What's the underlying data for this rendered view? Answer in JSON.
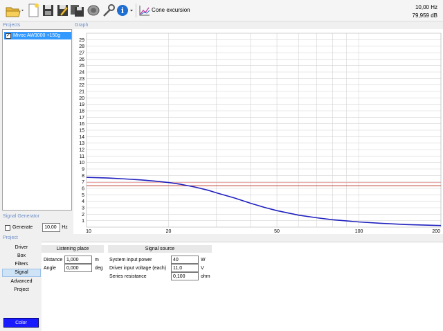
{
  "toolbar": {
    "mode_label": "Cone excursion",
    "frequency_readout": "10,00 Hz",
    "level_readout": "79,959 dB"
  },
  "sections": {
    "projects": "Projects",
    "graph": "Graph",
    "signal_generator": "Signal Generator",
    "project": "Project"
  },
  "projects": [
    {
      "name": "Mivoc AW3000 +150g",
      "checked": true
    }
  ],
  "signal_generator": {
    "generate_label": "Generate",
    "frequency": "10,00",
    "unit": "Hz"
  },
  "project_nav": [
    "Driver",
    "Box",
    "Filters",
    "Signal",
    "Advanced",
    "Project"
  ],
  "project_nav_active": "Signal",
  "color_button": "Color",
  "listening_place": {
    "title": "Listening place",
    "distance_label": "Distance",
    "distance_value": "1,000",
    "distance_unit": "m",
    "angle_label": "Angle",
    "angle_value": "0,000",
    "angle_unit": "deg"
  },
  "signal_source": {
    "title": "Signal source",
    "power_label": "System input power",
    "power_value": "40",
    "power_unit": "W",
    "voltage_label": "Driver input voltage (each)",
    "voltage_value": "11,0",
    "voltage_unit": "V",
    "resistance_label": "Series resistance",
    "resistance_value": "0,100",
    "resistance_unit": "ohm"
  },
  "chart_data": {
    "type": "line",
    "x_scale": "log",
    "xlim": [
      10,
      200
    ],
    "ylim": [
      0,
      30
    ],
    "x_ticks": [
      "10",
      "20",
      "50",
      "100",
      "200"
    ],
    "y_ticks": [
      "1",
      "2",
      "3",
      "4",
      "5",
      "6",
      "7",
      "8",
      "9",
      "10",
      "11",
      "12",
      "13",
      "14",
      "15",
      "16",
      "17",
      "18",
      "19",
      "20",
      "21",
      "22",
      "23",
      "24",
      "25",
      "26",
      "27",
      "28",
      "29"
    ],
    "grid": true,
    "series": [
      {
        "color": "#1f1fbf",
        "x": [
          10,
          12,
          14,
          16,
          18,
          20,
          22,
          25,
          28,
          30,
          35,
          40,
          45,
          50,
          60,
          70,
          80,
          100,
          120,
          150,
          200
        ],
        "y": [
          7.7,
          7.6,
          7.45,
          7.3,
          7.1,
          6.9,
          6.65,
          6.2,
          5.7,
          5.3,
          4.5,
          3.7,
          3.05,
          2.55,
          1.85,
          1.45,
          1.15,
          0.8,
          0.6,
          0.4,
          0.25
        ]
      }
    ],
    "reference_lines": [
      {
        "y": 6.9,
        "color": "#e9a3a3"
      },
      {
        "y": 6.4,
        "color": "#c0392b"
      }
    ]
  }
}
